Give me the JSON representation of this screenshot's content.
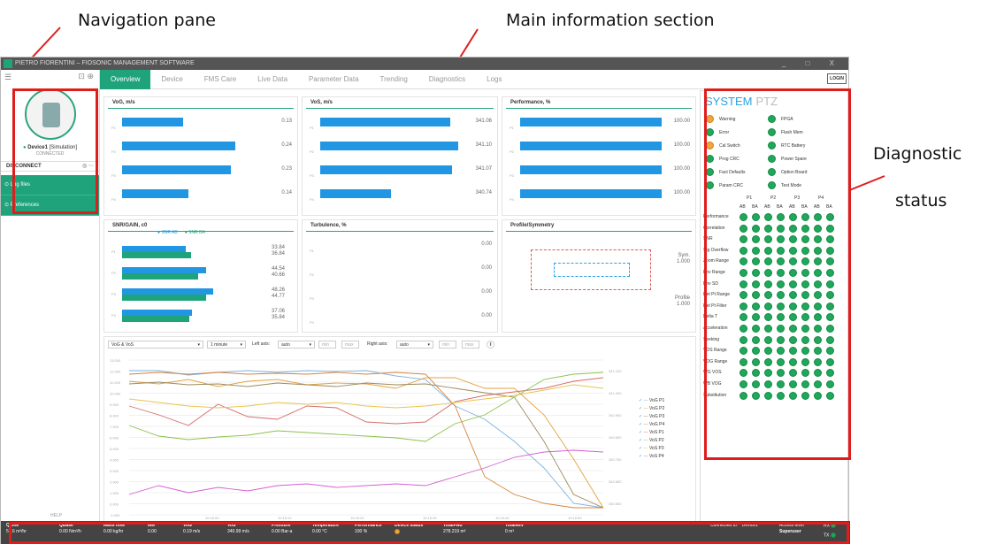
{
  "annotations": {
    "nav": "Navigation pane",
    "main": "Main information section",
    "diag1": "Diagnostic",
    "diag2": "status"
  },
  "app": {
    "title": "PIETRO FIORENTINI – FIOSONIC MANAGEMENT SOFTWARE",
    "window_controls": "_ □ X"
  },
  "nav": {
    "device_name": "Device1",
    "device_mode": "[Simulation]",
    "device_status": "CONNECTED",
    "disconnect": "DISCONNECT",
    "log_files": "Log files",
    "preferences": "Preferences",
    "help": "HELP"
  },
  "tabs": [
    "Overview",
    "Device",
    "FMS Care",
    "Live Data",
    "Parameter Data",
    "Trending",
    "Diagnostics",
    "Logs"
  ],
  "login": "LOGIN",
  "vog": {
    "title": "VoG, m/s",
    "labels": [
      "P1",
      "P2",
      "P3",
      "P4"
    ],
    "values": [
      0.13,
      0.24,
      0.23,
      0.14
    ],
    "axis": [
      "0.00",
      "0.20"
    ]
  },
  "vos": {
    "title": "VoS, m/s",
    "labels": [
      "P1",
      "P2",
      "P3",
      "P4"
    ],
    "values": [
      341.06,
      341.1,
      341.07,
      340.74
    ],
    "axis": [
      "",
      "341.00",
      ""
    ]
  },
  "perf": {
    "title": "Performance, %",
    "labels": [
      "P1",
      "P2",
      "P3",
      "P4"
    ],
    "values": [
      "100.00",
      "100.00",
      "100.00",
      "100.00"
    ],
    "axis": [
      "0",
      "50",
      "100"
    ]
  },
  "snr": {
    "title": "SNR/GAIN, c0",
    "legend": [
      "SNR AB",
      "SNR BA"
    ],
    "labels": [
      "P1",
      "P2",
      "P3",
      "P4"
    ],
    "ab": [
      33.84,
      44.54,
      48.26,
      37.06
    ],
    "ba": [
      36.84,
      40.66,
      44.77,
      35.84
    ],
    "axis": [
      "0",
      "40",
      "80"
    ]
  },
  "turb": {
    "title": "Turbulence, %",
    "labels": [
      "P1",
      "P2",
      "P3",
      "P4"
    ],
    "values": [
      "0.00",
      "0.00",
      "0.00",
      "0.00"
    ],
    "axis": [
      "0",
      "2"
    ]
  },
  "prof": {
    "title": "Profile/Symmetry",
    "sym_label": "Sym.",
    "sym": "1.000",
    "prof_label": "Profile",
    "prof": "1.000",
    "yaxis": [
      "1.2",
      "1.1",
      "1",
      "0.9",
      "0.8"
    ],
    "xaxis": [
      "",
      "1.4"
    ]
  },
  "trend": {
    "series_select": "VoG & VoS",
    "interval": "1 minute",
    "left_axis": "Left axis:",
    "right_axis": "Right axis:",
    "auto": "auto",
    "min": "min",
    "max": "max",
    "yleft": [
      "13.000",
      "12.000",
      "11.000",
      "10.000",
      "9.000",
      "8.000",
      "7.000",
      "6.000",
      "5.000",
      "4.000",
      "3.000",
      "2.000",
      "1.000",
      "0.000",
      "-1.000"
    ],
    "yright": [
      "341.100",
      "341.000",
      "340.900",
      "340.800",
      "340.700",
      "340.600",
      "340.500"
    ],
    "xaxis": [
      "10:16:00",
      "10:16:10",
      "10:16:20",
      "10:16:30",
      "10:16:40",
      "10:16:50",
      "10:17:00"
    ],
    "legend": [
      "VoG P1",
      "VoG P2",
      "VoG P3",
      "VoG P4",
      "VoS P1",
      "VoS P2",
      "VoS P3",
      "VoS P4"
    ],
    "colors": [
      "#7fb3e0",
      "#e6a13c",
      "#9b8a5a",
      "#d4843c",
      "#d46a6a",
      "#8ac24a",
      "#e9c34d",
      "#d35fd4"
    ]
  },
  "system": {
    "title": "SYSTEM",
    "alt": "PTZ",
    "left": [
      [
        "Warning",
        "amb"
      ],
      [
        "Error",
        "grn"
      ],
      [
        "Cal Switch",
        "amb"
      ],
      [
        "Prog CRC",
        "grn"
      ],
      [
        "Fact Defaults",
        "grn"
      ],
      [
        "Param CRC",
        "grn"
      ]
    ],
    "right": [
      [
        "FPGA",
        "grn"
      ],
      [
        "Flash Mem",
        "grn"
      ],
      [
        "RTC Battery",
        "grn"
      ],
      [
        "Power Spare",
        "grn"
      ],
      [
        "Option Board",
        "grn"
      ],
      [
        "Test Mode",
        "grn"
      ]
    ]
  },
  "matrix": {
    "paths": [
      "P1",
      "P2",
      "P3",
      "P4"
    ],
    "sub": [
      "AB",
      "BA",
      "AB",
      "BA",
      "AB",
      "BA",
      "AB",
      "BA"
    ],
    "rows": [
      "Performance",
      "Correlation",
      "SNR",
      "Sig Overflow",
      "Zoom Range",
      "Env Range",
      "Env SD",
      "Det Pt Range",
      "Det Pt Filter",
      "Delta T",
      "Acceleration",
      "Seeking",
      "VOS Range",
      "VOG Range",
      "WG VOS",
      "WB VOG",
      "Substitution"
    ]
  },
  "status": {
    "items": [
      [
        "QLine",
        "5.16 m³/hr"
      ],
      [
        "QBase",
        "0.00 Nm³/h"
      ],
      [
        "Mass flow",
        "0.00 kg/hr"
      ],
      [
        "Mw",
        "0.00"
      ],
      [
        "VoG",
        "0.19 m/s"
      ],
      [
        "VoS",
        "340.99 m/s"
      ],
      [
        "Pressure",
        "0.00 Bar-a"
      ],
      [
        "Temperature",
        "0.00 °C"
      ],
      [
        "Performance",
        "100 %"
      ],
      [
        "Device status",
        ""
      ],
      [
        "TotalFwd",
        "278.219 m³"
      ],
      [
        "TotalRev",
        "0 m³"
      ]
    ],
    "connected": "Connected to: \" Device1 \"",
    "access_label": "Access level",
    "access": "Superuser",
    "rx": "RX",
    "tx": "TX"
  }
}
